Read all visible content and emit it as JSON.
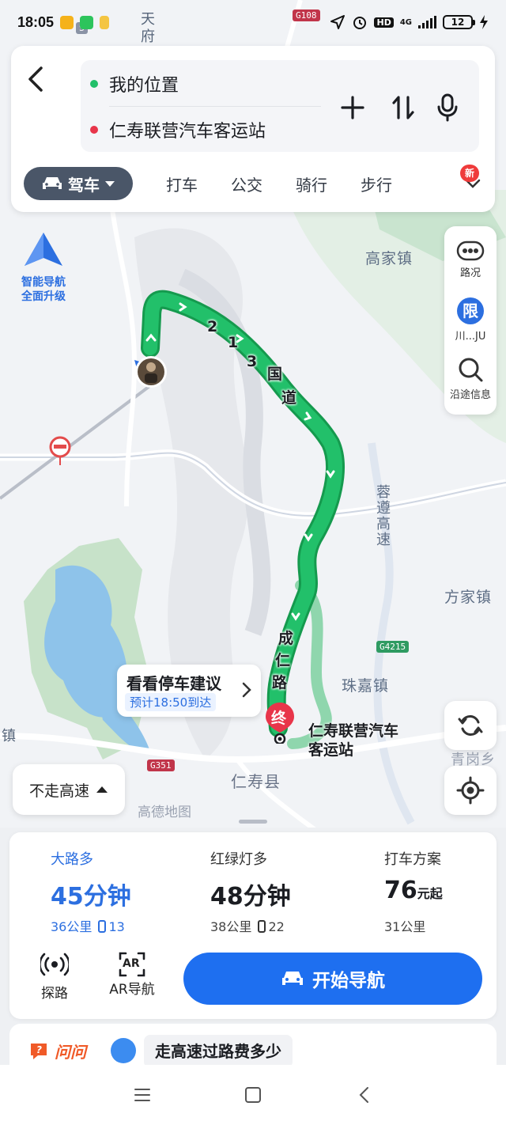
{
  "status_bar": {
    "time": "18:05",
    "network": "4G",
    "hd": "HD",
    "battery": "12"
  },
  "top_card": {
    "origin": "我的位置",
    "destination": "仁寿联营汽车客运站",
    "modes": [
      "驾车",
      "打车",
      "公交",
      "骑行",
      "步行"
    ],
    "new_badge": "新"
  },
  "map": {
    "smart_nav_line1": "智能导航",
    "smart_nav_line2": "全面升级",
    "side_panel": {
      "traffic": "路况",
      "restrict_icon": "限",
      "restrict_label": "川...JU",
      "along_route": "沿途信息"
    },
    "labels": {
      "tianfu_top": "天",
      "tianfu_bottom": "府",
      "gaojia": "高家镇",
      "fangjia": "方家镇",
      "zhujia": "珠嘉镇",
      "renshou": "仁寿县",
      "qinggang": "青岗乡",
      "zhen_left": "镇",
      "rongzun": "蓉遵高速"
    },
    "road_badges": {
      "g108": "G108",
      "g4215": "G4215",
      "g351": "G351",
      "s_top": "S"
    },
    "route_road_name_1": [
      "2",
      "1",
      "3",
      "国",
      "道"
    ],
    "route_road_name_2": [
      "成",
      "仁",
      "路"
    ],
    "parking": {
      "title": "看看停车建议",
      "eta": "预计18:50到达"
    },
    "dest_marker": "终",
    "dest_name_line1": "仁寿联营汽车",
    "dest_name_line2": "客运站",
    "no_highway": "不走高速",
    "watermark": "高德地图"
  },
  "routes": [
    {
      "tag": "大路多",
      "time_num": "45",
      "time_unit": "分钟",
      "distance": "36公里",
      "lights": "13"
    },
    {
      "tag": "红绿灯多",
      "time_num": "48",
      "time_unit": "分钟",
      "distance": "38公里",
      "lights": "22"
    },
    {
      "tag": "打车方案",
      "time_num": "76",
      "time_unit": "元起",
      "distance": "31公里"
    }
  ],
  "tools": {
    "explore": "探路",
    "ar_nav": "AR导航",
    "ar_icon": "AR",
    "start_nav": "开始导航"
  },
  "ask": {
    "logo": "问问",
    "suggestion": "走高速过路费多少"
  },
  "colors": {
    "route_green": "#1fb262",
    "accent_blue": "#1e6ff0",
    "dest_red": "#e8354a"
  }
}
